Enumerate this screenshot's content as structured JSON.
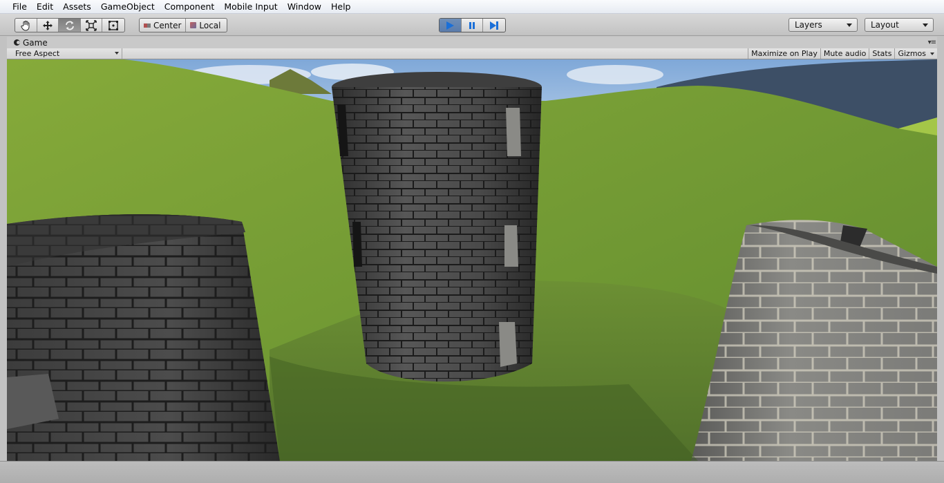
{
  "menubar": {
    "items": [
      "File",
      "Edit",
      "Assets",
      "GameObject",
      "Component",
      "Mobile Input",
      "Window",
      "Help"
    ]
  },
  "toolbar": {
    "transform_tools": [
      {
        "name": "hand-tool",
        "icon": "hand-icon"
      },
      {
        "name": "move-tool",
        "icon": "move-arrows-icon"
      },
      {
        "name": "rotate-tool",
        "icon": "rotate-icon",
        "active": true
      },
      {
        "name": "scale-tool",
        "icon": "scale-icon"
      },
      {
        "name": "rect-tool",
        "icon": "rect-icon"
      }
    ],
    "pivot_label": "Center",
    "space_label": "Local",
    "play_state": "playing",
    "layers_label": "Layers",
    "layout_label": "Layout"
  },
  "game_panel": {
    "tab_label": "Game",
    "aspect_label": "Free Aspect",
    "maximize_label": "Maximize on Play",
    "mute_label": "Mute audio",
    "stats_label": "Stats",
    "gizmos_label": "Gizmos"
  },
  "colors": {
    "play_accent": "#5a7cab",
    "grass": "#6f8e3c",
    "sky": "#8fb3dc",
    "stone": "#4a4a4a"
  }
}
